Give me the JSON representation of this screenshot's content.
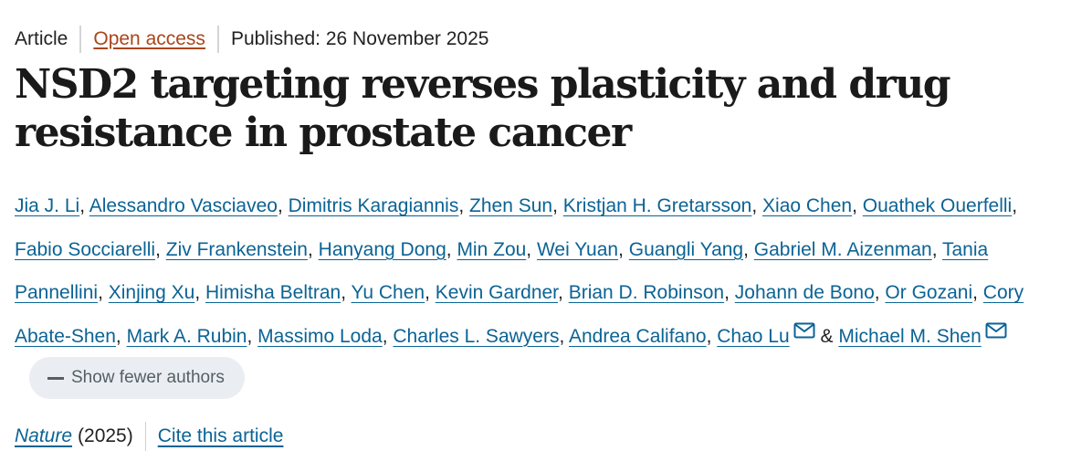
{
  "meta": {
    "type": "Article",
    "access": "Open access",
    "published": "Published: 26 November 2025"
  },
  "title": "NSD2 targeting reverses plasticity and drug resistance in prostate cancer",
  "authors": [
    "Jia J. Li",
    "Alessandro Vasciaveo",
    "Dimitris Karagiannis",
    "Zhen Sun",
    "Kristjan H. Gretarsson",
    "Xiao Chen",
    "Ouathek Ouerfelli",
    "Fabio Socciarelli",
    "Ziv Frankenstein",
    "Hanyang Dong",
    "Min Zou",
    "Wei Yuan",
    "Guangli Yang",
    "Gabriel M. Aizenman",
    "Tania Pannellini",
    "Xinjing Xu",
    "Himisha Beltran",
    "Yu Chen",
    "Kevin Gardner",
    "Brian D. Robinson",
    "Johann de Bono",
    "Or Gozani",
    "Cory Abate-Shen",
    "Mark A. Rubin",
    "Massimo Loda",
    "Charles L. Sawyers",
    "Andrea Califano",
    "Chao Lu",
    "Michael M. Shen"
  ],
  "corresponding_authors": [
    "Chao Lu",
    "Michael M. Shen"
  ],
  "authors_ui": {
    "separator": ", ",
    "last_separator": " & ",
    "show_fewer_label": "Show fewer authors",
    "mail_icon": "envelope-icon"
  },
  "footer": {
    "journal": "Nature",
    "year": "(2025)",
    "cite_label": "Cite this article"
  },
  "colors": {
    "link": "#0b6395",
    "open_access": "#a8461a",
    "pill_bg": "#eaeef3",
    "text": "#222222"
  }
}
